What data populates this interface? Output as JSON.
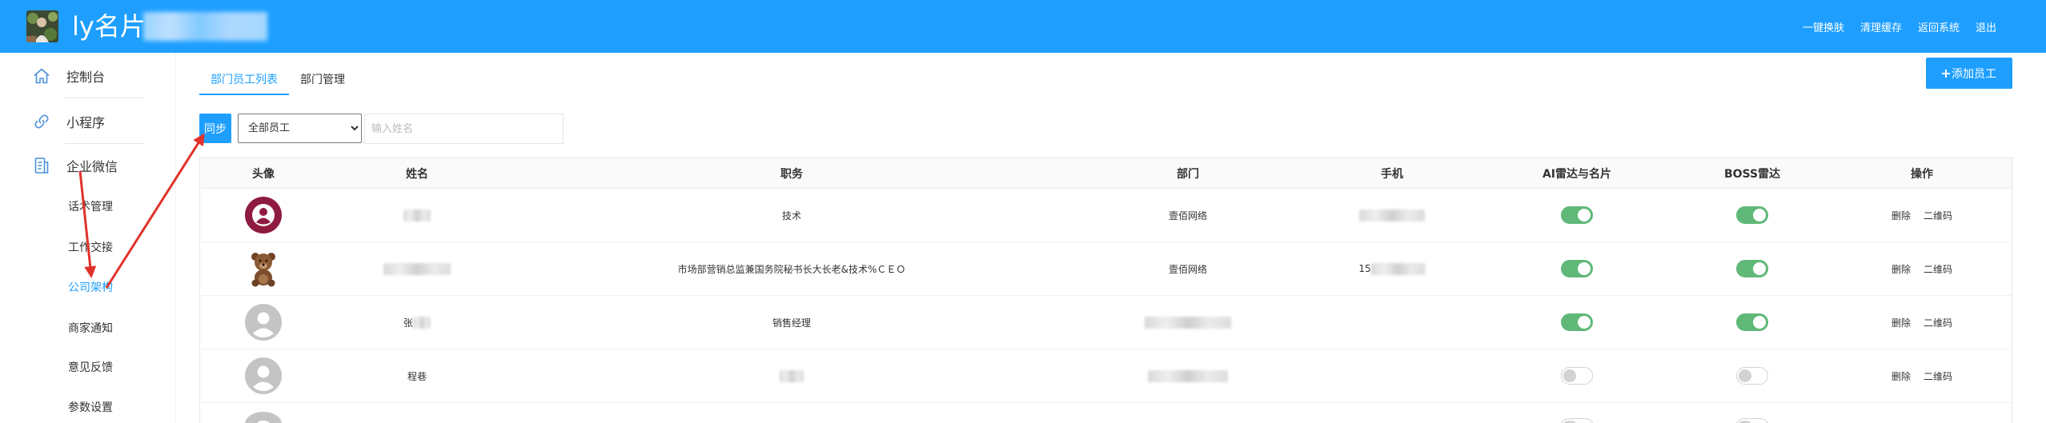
{
  "header": {
    "title": "ly名片",
    "links": [
      "一键换肤",
      "清理缓存",
      "返回系统",
      "退出"
    ]
  },
  "sidebar": {
    "items": [
      {
        "label": "控制台",
        "icon": "home-icon"
      },
      {
        "label": "小程序",
        "icon": "link-icon"
      },
      {
        "label": "企业微信",
        "icon": "document-icon"
      }
    ],
    "sub_items": [
      "话术管理",
      "工作交接",
      "公司架构",
      "商家通知",
      "意见反馈",
      "参数设置"
    ],
    "active_sub_item": "公司架构"
  },
  "tabs": [
    {
      "label": "部门员工列表",
      "active": true
    },
    {
      "label": "部门管理",
      "active": false
    }
  ],
  "toolbar": {
    "sync_label": "同步",
    "filter_selected": "全部员工",
    "search_placeholder": "输入姓名",
    "add_icon": "plus-icon",
    "add_label": "添加员工"
  },
  "table": {
    "columns": [
      "头像",
      "姓名",
      "职务",
      "部门",
      "手机",
      "AI雷达与名片",
      "BOSS雷达",
      "操作"
    ],
    "actions": [
      "删除",
      "二维码"
    ],
    "rows": [
      {
        "avatar": "maroon-person-avatar",
        "name": "",
        "name_redacted": true,
        "title": "技术",
        "dept": "壹佰网络",
        "phone": "",
        "phone_redacted": true,
        "ai_radar": true,
        "boss_radar": true
      },
      {
        "avatar": "teddy-bear-avatar",
        "name": "",
        "name_redacted": true,
        "title": "市场部营销总监兼国务院秘书长大长老&技术%ＣＥＯ",
        "dept": "壹佰网络",
        "phone": "15",
        "phone_redacted": true,
        "ai_radar": true,
        "boss_radar": true
      },
      {
        "avatar": "default-person-avatar",
        "name": "张",
        "name_redacted": true,
        "title": "销售经理",
        "dept": "",
        "dept_redacted": true,
        "phone": "",
        "ai_radar": true,
        "boss_radar": true
      },
      {
        "avatar": "default-person-avatar",
        "name": "程巷",
        "title": "",
        "title_redacted": true,
        "dept": "",
        "dept_redacted": true,
        "phone": "",
        "ai_radar": false,
        "boss_radar": false
      },
      {
        "avatar": "default-person-avatar",
        "name": "",
        "title": "",
        "dept": "",
        "phone": "",
        "ai_radar": false,
        "boss_radar": false
      }
    ]
  },
  "theme": {
    "primary": "#1e9fff",
    "switch_on": "#5fb878",
    "annotation": "#e0322a"
  }
}
